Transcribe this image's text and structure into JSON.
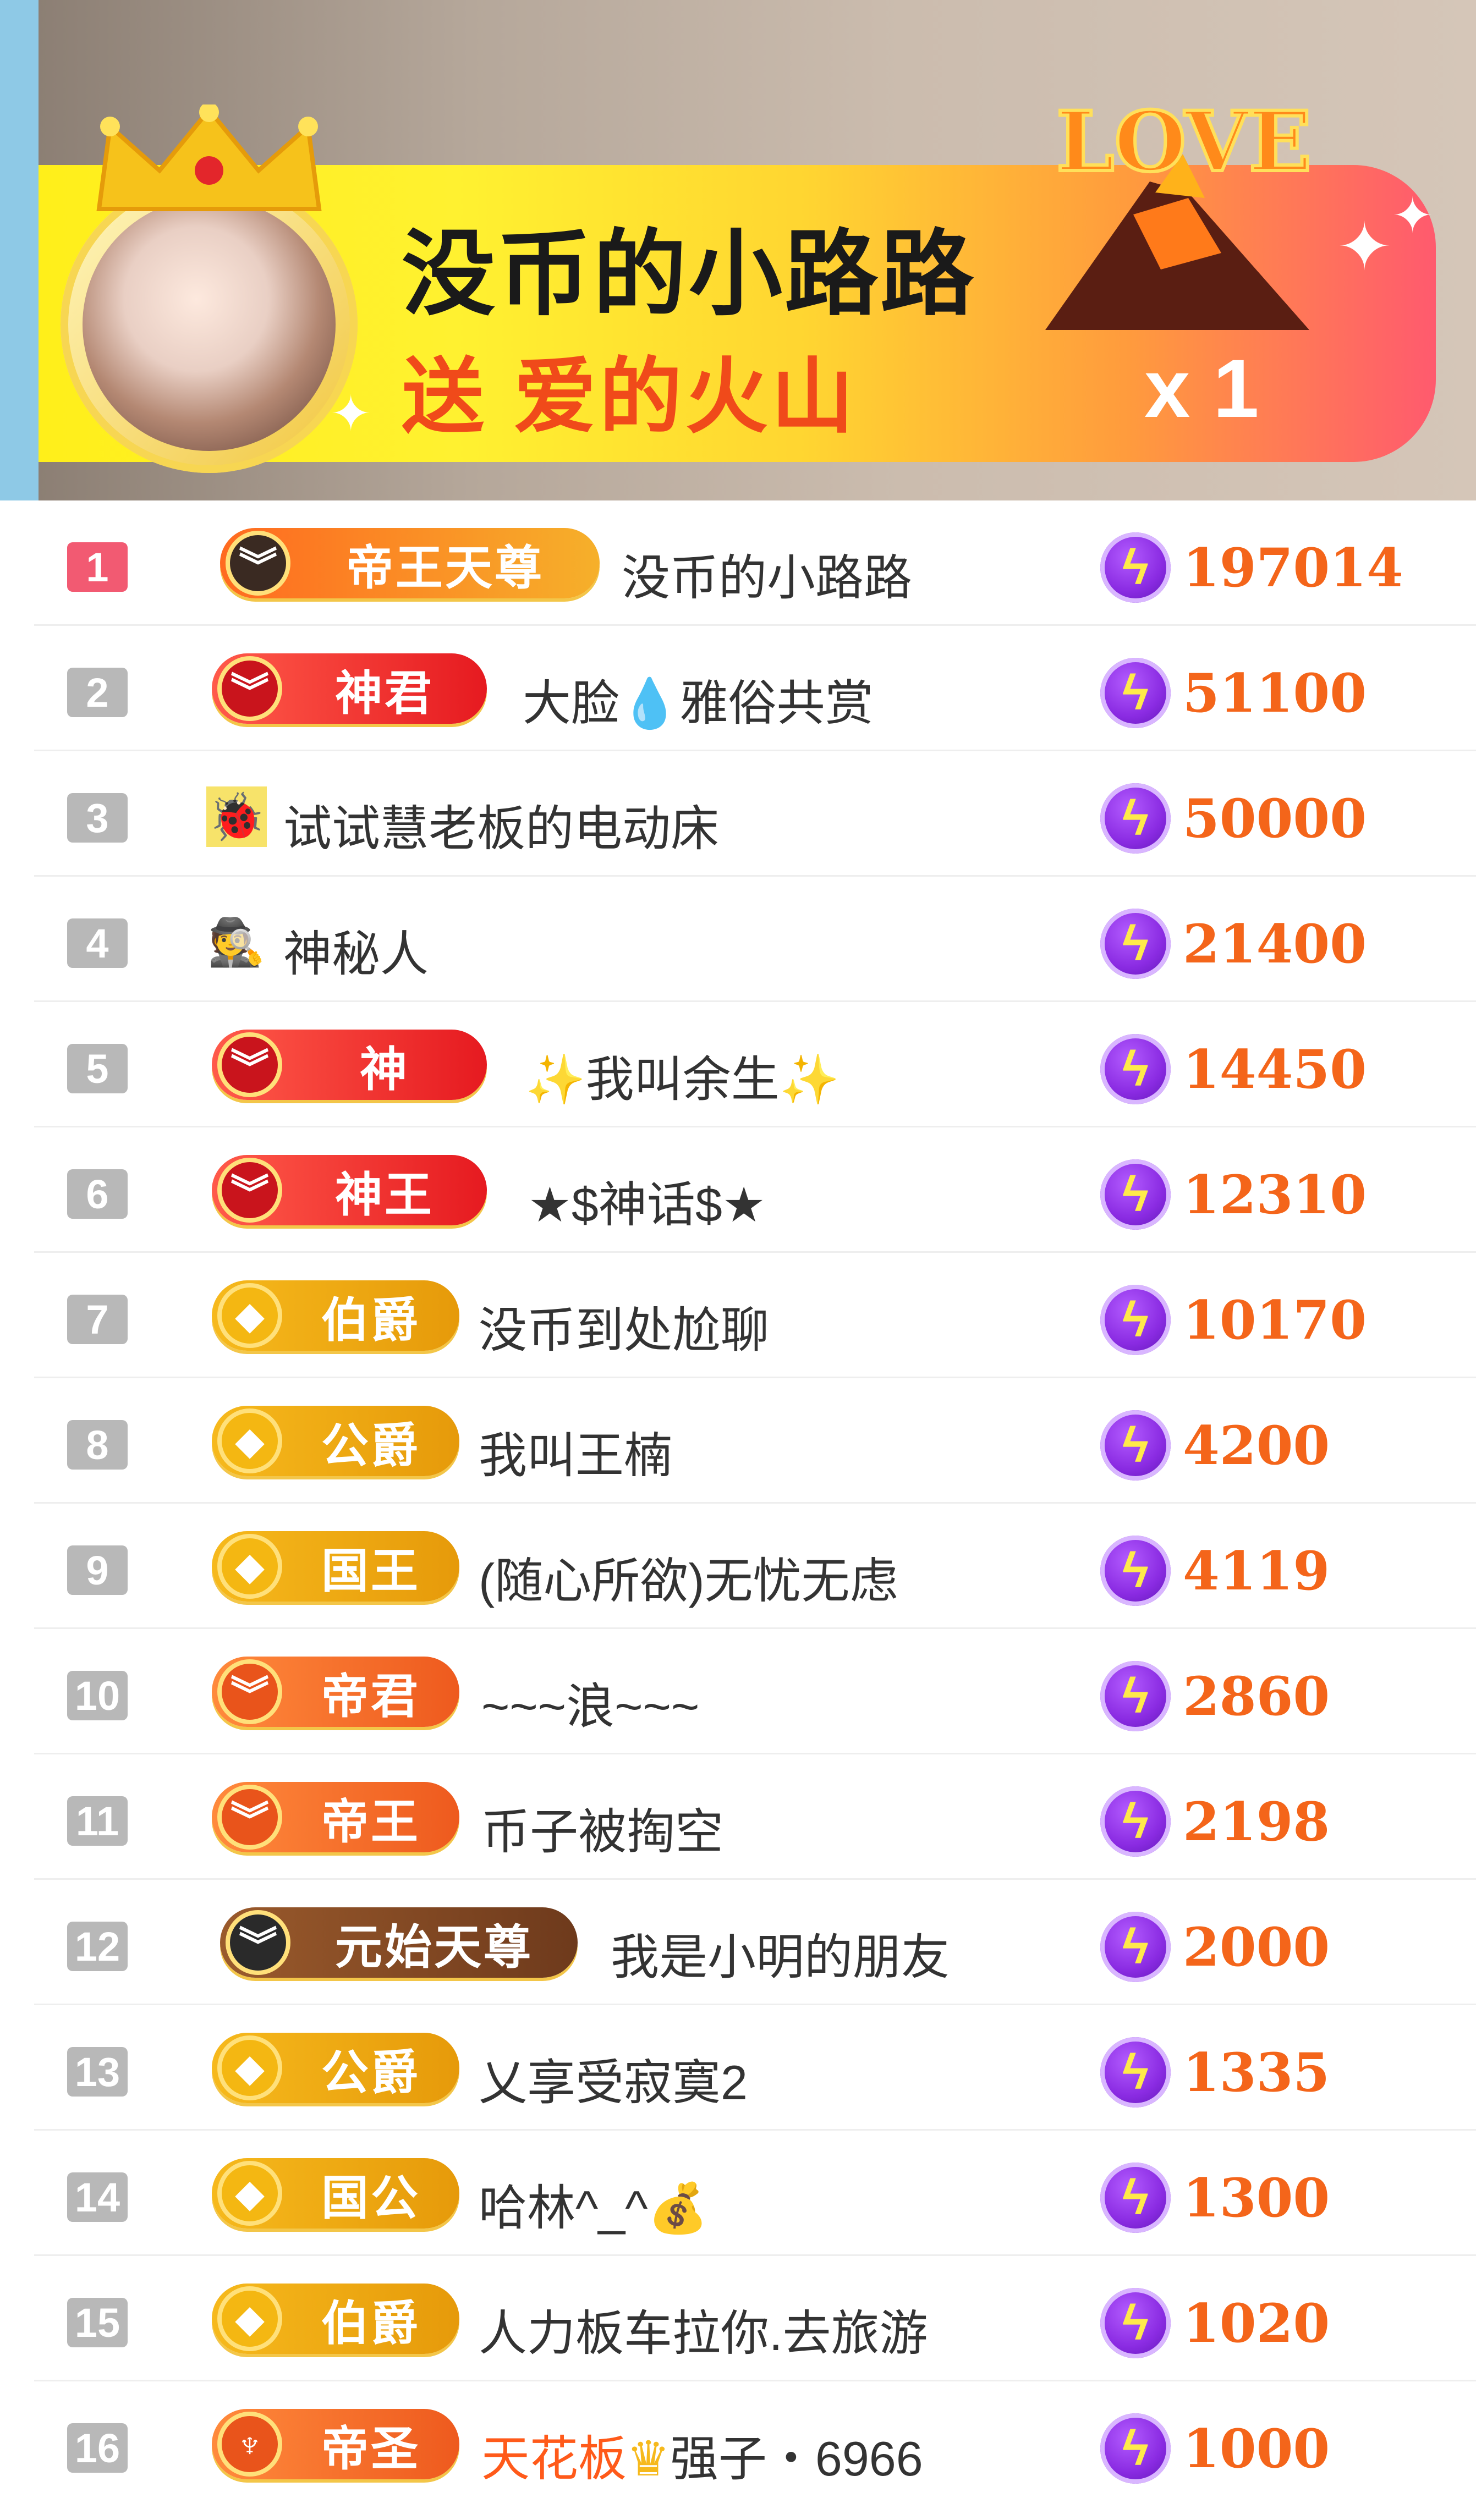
{
  "banner": {
    "sender_name": "没币的小路路",
    "gift_text": "送 爱的火山",
    "gift_count": "x 1",
    "gift_icon": "love-volcano-icon",
    "gift_logo_text": "LOVE"
  },
  "colors": {
    "accent_orange": "#f4651a",
    "rank_first": "#f25a72",
    "rank_other": "#b8b8b8",
    "coin_purple": "#8a2be2"
  },
  "ranking": [
    {
      "rank": "1",
      "badge": "帝王天尊",
      "name": "没币的小路路",
      "score": "197014"
    },
    {
      "rank": "2",
      "badge": "神君",
      "name": "大脸💧雅俗共赏",
      "score": "51100"
    },
    {
      "rank": "3",
      "badge": "",
      "name": "试试慧老板的电动床",
      "score": "50000"
    },
    {
      "rank": "4",
      "badge": "",
      "name": "神秘人",
      "score": "21400"
    },
    {
      "rank": "5",
      "badge": "神",
      "name": "✨我叫余生✨",
      "score": "14450"
    },
    {
      "rank": "6",
      "badge": "神王",
      "name": "★$神话$★",
      "score": "12310"
    },
    {
      "rank": "7",
      "badge": "伯爵",
      "name": "没币到处尬聊",
      "score": "10170"
    },
    {
      "rank": "8",
      "badge": "公爵",
      "name": "我叫王楠",
      "score": "4200"
    },
    {
      "rank": "9",
      "badge": "国王",
      "name": "(随心所欲)无忧无虑",
      "score": "4119"
    },
    {
      "rank": "10",
      "badge": "帝君",
      "name": "~~~浪~~~",
      "score": "2860"
    },
    {
      "rank": "11",
      "badge": "帝王",
      "name": "币子被掏空",
      "score": "2198"
    },
    {
      "rank": "12",
      "badge": "元始天尊",
      "name": "我是小明的朋友",
      "score": "2000"
    },
    {
      "rank": "13",
      "badge": "公爵",
      "name": "乂享受寂寞2",
      "score": "1335"
    },
    {
      "rank": "14",
      "badge": "国公",
      "name": "哈林^_^💰",
      "score": "1300"
    },
    {
      "rank": "15",
      "badge": "伯爵",
      "name": "人力板车拉你.去旅游",
      "score": "1020"
    },
    {
      "rank": "16",
      "badge": "帝圣",
      "name_highlight": "天花板",
      "name": "强子・6966",
      "score": "1000"
    }
  ]
}
